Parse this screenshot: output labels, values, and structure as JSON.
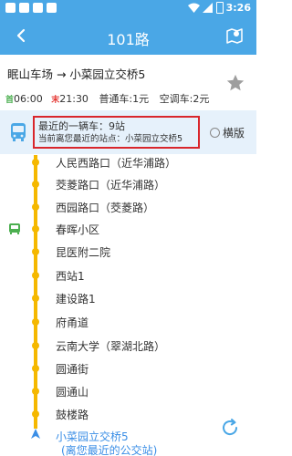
{
  "status_bar": {
    "time": "3:26",
    "icons": [
      "notification-square-icon",
      "notification-square-icon",
      "notification-square-icon",
      "notification-square-icon",
      "wifi-icon",
      "signal-icon",
      "battery-icon"
    ]
  },
  "app_bar": {
    "title": "101路",
    "back_icon": "back-arrow-icon",
    "map_icon": "map-pin-icon",
    "color": "#4aa7e6"
  },
  "route": {
    "direction": "眠山车场 → 小菜园立交桥5",
    "first_tag": "首",
    "first_time": "06:00",
    "last_tag": "末",
    "last_time": "21:30",
    "fare_normal": "普通车:1元",
    "fare_ac": "空调车:2元",
    "favorite_icon": "star-icon"
  },
  "info": {
    "nearest_bus": "最近的一辆车：9站",
    "nearest_stop": "当前离您最近的站点：小菜园立交桥5",
    "landscape_label": "横版"
  },
  "stops": [
    "人民西路口（近华浦路）",
    "茭菱路口（近华浦路）",
    "西园路口（茭菱路）",
    "春晖小区",
    "昆医附二院",
    "西站1",
    "建设路1",
    "府甬道",
    "云南大学（翠湖北路）",
    "圆通街",
    "圆通山",
    "鼓楼路"
  ],
  "destination": {
    "name": "小菜园立交桥5",
    "note": "(离您最近的公交站)"
  },
  "colors": {
    "accent": "#4aa7e6",
    "track": "#f5b800",
    "highlight_border": "#d9262c",
    "destination_text": "#3a8ee6"
  }
}
